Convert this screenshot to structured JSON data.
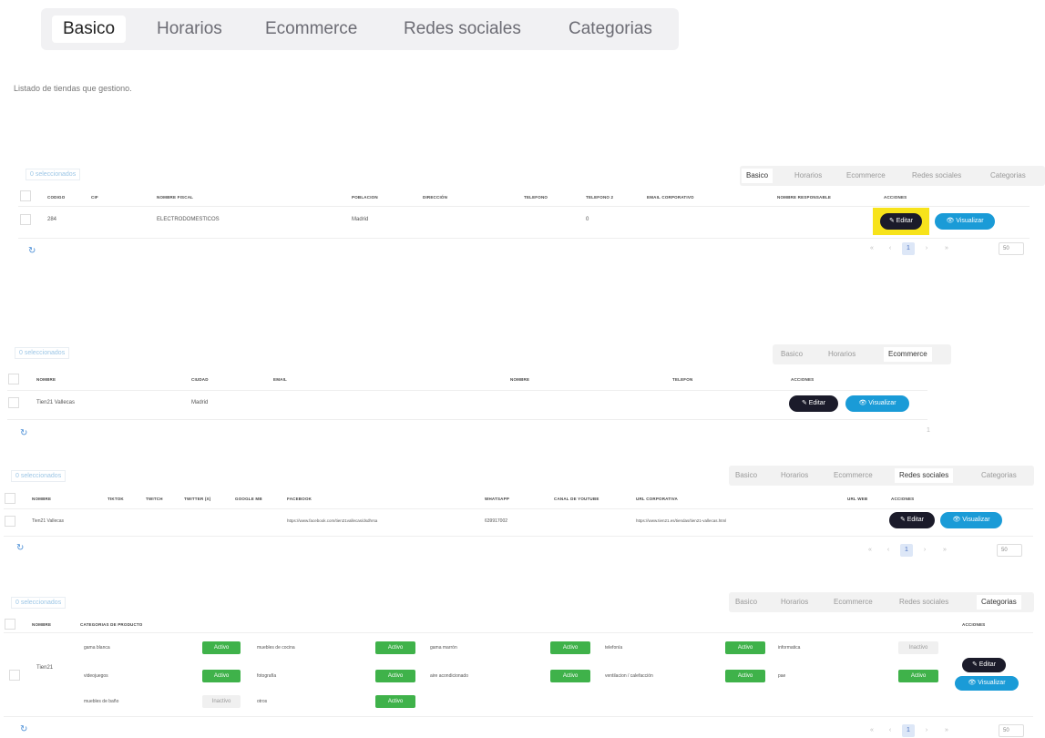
{
  "top_tabs": [
    "Basico",
    "Horarios",
    "Ecommerce",
    "Redes sociales",
    "Categorias"
  ],
  "intro": "Listado de tiendas que gestiono.",
  "selected_label": "0 seleccionados",
  "mini_tabs": [
    "Basico",
    "Horarios",
    "Ecommerce",
    "Redes sociales",
    "Categorias"
  ],
  "actions": {
    "edit": "✎ Editar",
    "view": "👁 Visualizar"
  },
  "basico": {
    "headers": [
      "CODIGO",
      "CIF",
      "NOMBRE FISCAL",
      "POBLACION",
      "DIRECCIÓN",
      "TELEFONO",
      "TELEFONO 2",
      "EMAIL CORPORATIVO",
      "NOMBRE RESPONSABLE",
      "ACCIONES"
    ],
    "row": {
      "codigo": "284",
      "nombre_fiscal": "ELECTRODOMESTICOS",
      "poblacion": "Madrid",
      "telefono2": "0"
    },
    "pager": [
      "«",
      "‹",
      "1",
      "›",
      "»"
    ],
    "page_size": "50"
  },
  "ecommerce": {
    "headers": [
      "NOMBRE",
      "CIUDAD",
      "EMAIL",
      "NOMBRE",
      "TELEFON",
      "ACCIONES"
    ],
    "row": {
      "nombre": "Tien21 Vallecas",
      "ciudad": "Madrid"
    },
    "pager": "1"
  },
  "redes": {
    "headers": [
      "NOMBRE",
      "TIKTOK",
      "TWITCH",
      "TWITTER (X)",
      "GOOGLE MB",
      "FACEBOOK",
      "WHATSAPP",
      "CANAL DE YOUTUBE",
      "URL CORPORATIVA",
      "URL WEB",
      "ACCIONES"
    ],
    "row": {
      "nombre": "Tien21 Vallecas",
      "facebook": "https://www.facebook.com/tien21vallecas/dsdhrsa",
      "whatsapp": "639917002",
      "url_corporativa": "https://www.tien21.es/tiendas/tien21-vallecas.html"
    },
    "pager": [
      "«",
      "‹",
      "1",
      "›",
      "»"
    ],
    "page_size": "50"
  },
  "categorias": {
    "headers": [
      "NOMBRE",
      "CATEGORIAS DE PRODUCTO",
      "ACCIONES"
    ],
    "row_name": "Tien21",
    "items": [
      {
        "name": "gama blanca",
        "status": "Activo"
      },
      {
        "name": "muebles de cocina",
        "status": "Activo"
      },
      {
        "name": "gama marrón",
        "status": "Activo"
      },
      {
        "name": "telefonía",
        "status": "Activo"
      },
      {
        "name": "informatica",
        "status": "Inactivo"
      },
      {
        "name": "videojuegos",
        "status": "Activo"
      },
      {
        "name": "fotografía",
        "status": "Activo"
      },
      {
        "name": "aire acondicionado",
        "status": "Activo"
      },
      {
        "name": "ventilacion / calefacción",
        "status": "Activo"
      },
      {
        "name": "pae",
        "status": "Activo"
      },
      {
        "name": "muebles de baño",
        "status": "Inactivo"
      },
      {
        "name": "otros",
        "status": "Activo"
      }
    ],
    "pager": [
      "«",
      "‹",
      "1",
      "›",
      "»"
    ],
    "page_size": "50"
  },
  "colors": {
    "edit": "#1b1b2a",
    "view": "#1a9bd7",
    "active": "#3fb24a",
    "highlight": "#f7e31b"
  }
}
